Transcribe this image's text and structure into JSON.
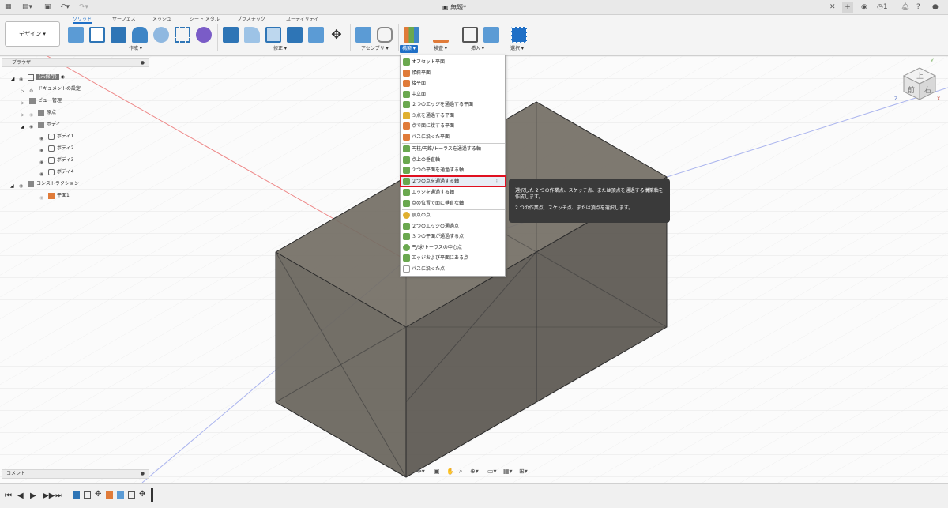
{
  "window": {
    "doc_title": "無題*"
  },
  "ribbon": {
    "workspace": "デザイン ▾",
    "tabs": [
      "ソリッド",
      "サーフェス",
      "メッシュ",
      "シート メタル",
      "プラスチック",
      "ユーティリティ"
    ],
    "groups": [
      "作成 ▾",
      "修正 ▾",
      "アセンブリ ▾",
      "構築 ▾",
      "検査 ▾",
      "挿入 ▾",
      "選択 ▾"
    ]
  },
  "browser": {
    "title": "ブラウザ",
    "nodes": [
      "(未保存)",
      "ドキュメントの設定",
      "ビュー管理",
      "原点",
      "ボディ",
      "ボディ1",
      "ボディ2",
      "ボディ3",
      "ボディ4",
      "コンストラクション",
      "平面1"
    ]
  },
  "construct_menu": {
    "items": [
      "オフセット平面",
      "傾斜平面",
      "接平面",
      "中立面",
      "２つのエッジを通過する平面",
      "３点を通過する平面",
      "点で面に接する平面",
      "パスに沿った平面",
      "円柱/円錐/トーラスを通過する軸",
      "点上の垂直軸",
      "２つの平面を通過する軸",
      "２つの点を通過する軸",
      "エッジを通過する軸",
      "点の位置で面に垂直な軸",
      "頂点の点",
      "２つのエッジの通過点",
      "３つの平面が通過する点",
      "円/球/トーラスの中心点",
      "エッジおよび平面にある点",
      "パスに沿った点"
    ]
  },
  "tooltip": {
    "line1": "選択した 2 つの作業点、スケッチ点、または頂点を通過する構築軸を作成します。",
    "line2": "2 つの作業点、スケッチ点、または頂点を選択します。"
  },
  "comments": {
    "title": "コメント"
  },
  "viewcube": {
    "top": "上",
    "front": "前",
    "right": "右",
    "axis_x": "X",
    "axis_y": "Y",
    "axis_z": "Z"
  },
  "colors": {
    "accent": "#1f6fc6",
    "highlight_border": "#e01020",
    "body": "#6d6a62"
  }
}
